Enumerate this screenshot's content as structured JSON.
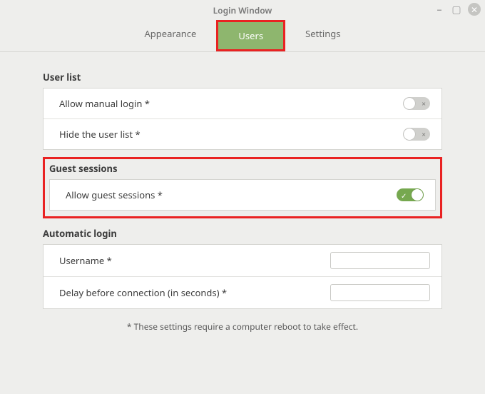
{
  "window": {
    "title": "Login Window"
  },
  "tabs": {
    "appearance": "Appearance",
    "users": "Users",
    "settings": "Settings"
  },
  "sections": {
    "user_list": {
      "title": "User list",
      "allow_manual_login": {
        "label": "Allow manual login *",
        "enabled": false
      },
      "hide_user_list": {
        "label": "Hide the user list *",
        "enabled": false
      }
    },
    "guest_sessions": {
      "title": "Guest sessions",
      "allow_guest": {
        "label": "Allow guest sessions *",
        "enabled": true
      }
    },
    "automatic_login": {
      "title": "Automatic login",
      "username": {
        "label": "Username *",
        "value": ""
      },
      "delay": {
        "label": "Delay before connection (in seconds) *",
        "value": ""
      }
    }
  },
  "footnote": "* These settings require a computer reboot to take effect."
}
